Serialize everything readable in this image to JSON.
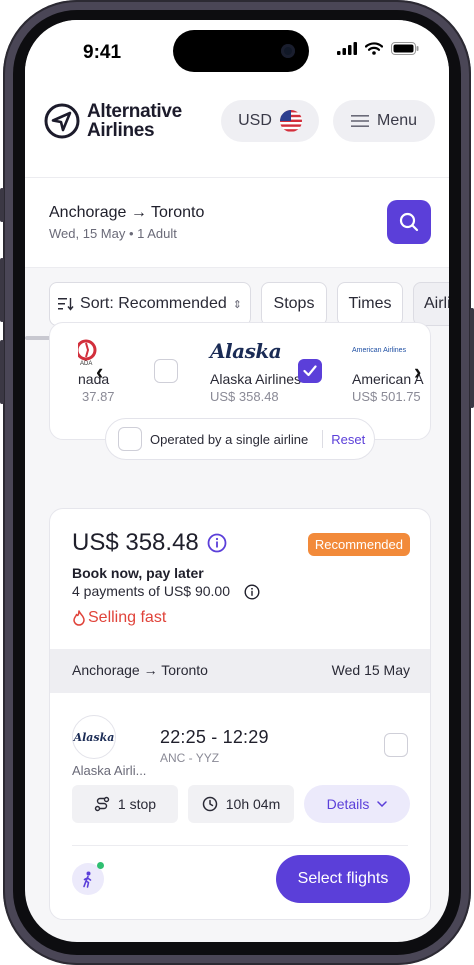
{
  "status_bar": {
    "time": "9:41"
  },
  "header": {
    "logo_line1": "Alternative",
    "logo_line2": "Airlines",
    "currency": "USD",
    "menu_label": "Menu"
  },
  "search": {
    "origin": "Anchorage",
    "destination": "Toronto",
    "details": "Wed, 15 May • 1 Adult"
  },
  "filters": {
    "sort_label": "Sort: Recommended",
    "chips": [
      "Stops",
      "Times",
      "Airli"
    ]
  },
  "airlines": [
    {
      "name": "nada",
      "price": "37.87",
      "logo_text": "ADA",
      "checked": false
    },
    {
      "name": "Alaska Airlines",
      "price": "US$ 358.48",
      "logo_text": "Alaska",
      "checked": true
    },
    {
      "name": "American A",
      "price": "US$ 501.75",
      "logo_text": "American Airlines",
      "checked": false
    }
  ],
  "single_airline": {
    "label": "Operated by a single airline",
    "reset": "Reset"
  },
  "flight": {
    "price": "US$ 358.48",
    "badge": "Recommended",
    "bnpl_title": "Book now, pay later",
    "payments": "4 payments of US$ 90.00",
    "selling": "Selling fast",
    "leg_from": "Anchorage",
    "leg_to": "Toronto",
    "leg_date": "Wed 15 May",
    "airline_short": "Alaska Airli...",
    "airline_logo_text": "Alaska",
    "times": "22:25 - 12:29",
    "codes": "ANC - YYZ",
    "stops": "1 stop",
    "duration": "10h 04m",
    "details": "Details",
    "select": "Select flights"
  },
  "colors": {
    "brand": "#5b3fd9",
    "badge": "#f28a3a",
    "selling": "#e0433a"
  }
}
